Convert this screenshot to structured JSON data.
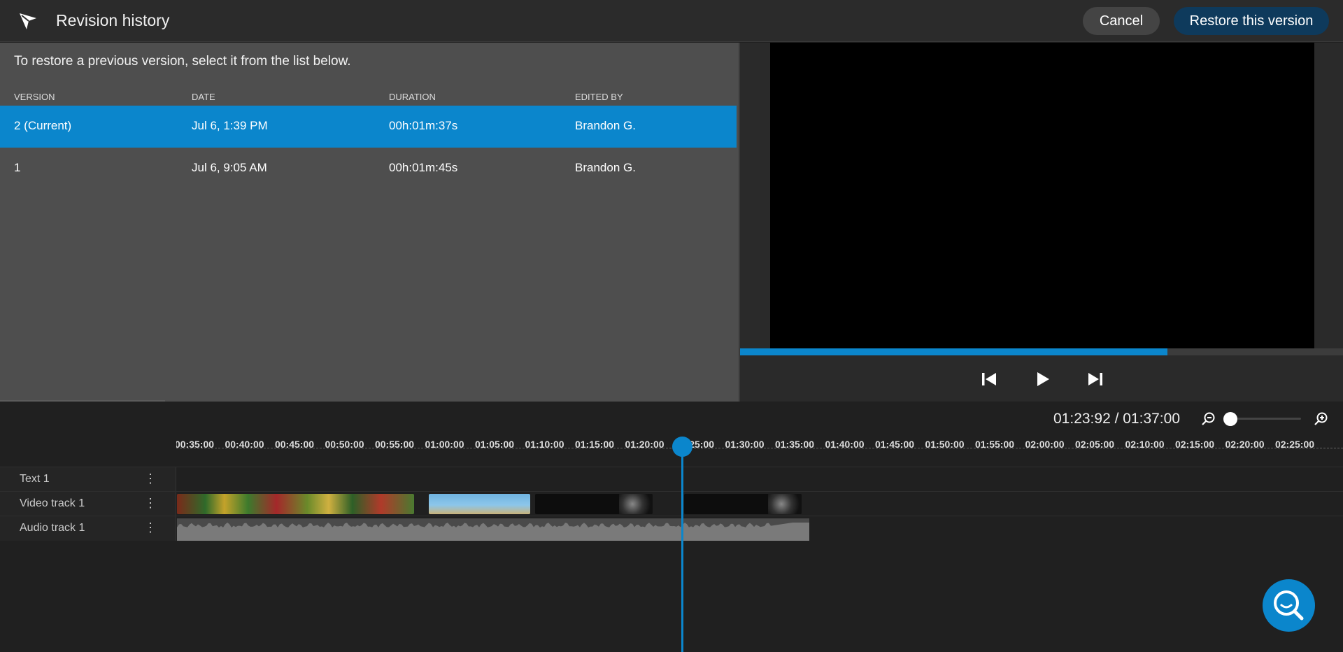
{
  "header": {
    "title": "Revision history",
    "cancel_label": "Cancel",
    "restore_label": "Restore this version"
  },
  "list": {
    "instruction": "To restore a previous version, select it from the list below.",
    "columns": [
      "VERSION",
      "DATE",
      "DURATION",
      "EDITED BY"
    ],
    "rows": [
      {
        "version": "2 (Current)",
        "date": "Jul 6, 1:39 PM",
        "duration": "00h:01m:37s",
        "edited_by": "Brandon G.",
        "selected": true
      },
      {
        "version": "1",
        "date": "Jul 6, 9:05 AM",
        "duration": "00h:01m:45s",
        "edited_by": "Brandon G.",
        "selected": false
      }
    ]
  },
  "preview": {
    "progress_fraction": 0.707,
    "icons": [
      "skip-back-icon",
      "play-icon",
      "skip-forward-icon"
    ]
  },
  "timeline": {
    "timecode": "01:23:92 / 01:37:00",
    "ruler_labels": [
      "00:35:00",
      "00:40:00",
      "00:45:00",
      "00:50:00",
      "00:55:00",
      "01:00:00",
      "01:05:00",
      "01:10:00",
      "01:15:00",
      "01:20:00",
      "01:25:00",
      "01:30:00",
      "01:35:00",
      "01:40:00",
      "01:45:00",
      "01:50:00",
      "01:55:00",
      "02:00:00",
      "02:05:00",
      "02:10:00",
      "02:15:00",
      "02:20:00",
      "02:25:00"
    ],
    "tracks": [
      {
        "label": "Text 1"
      },
      {
        "label": "Video track 1"
      },
      {
        "label": "Audio track 1"
      }
    ]
  },
  "colors": {
    "accent": "#0b86cc",
    "restore_button": "#0e3a5c",
    "panel": "#4e4e4e"
  }
}
